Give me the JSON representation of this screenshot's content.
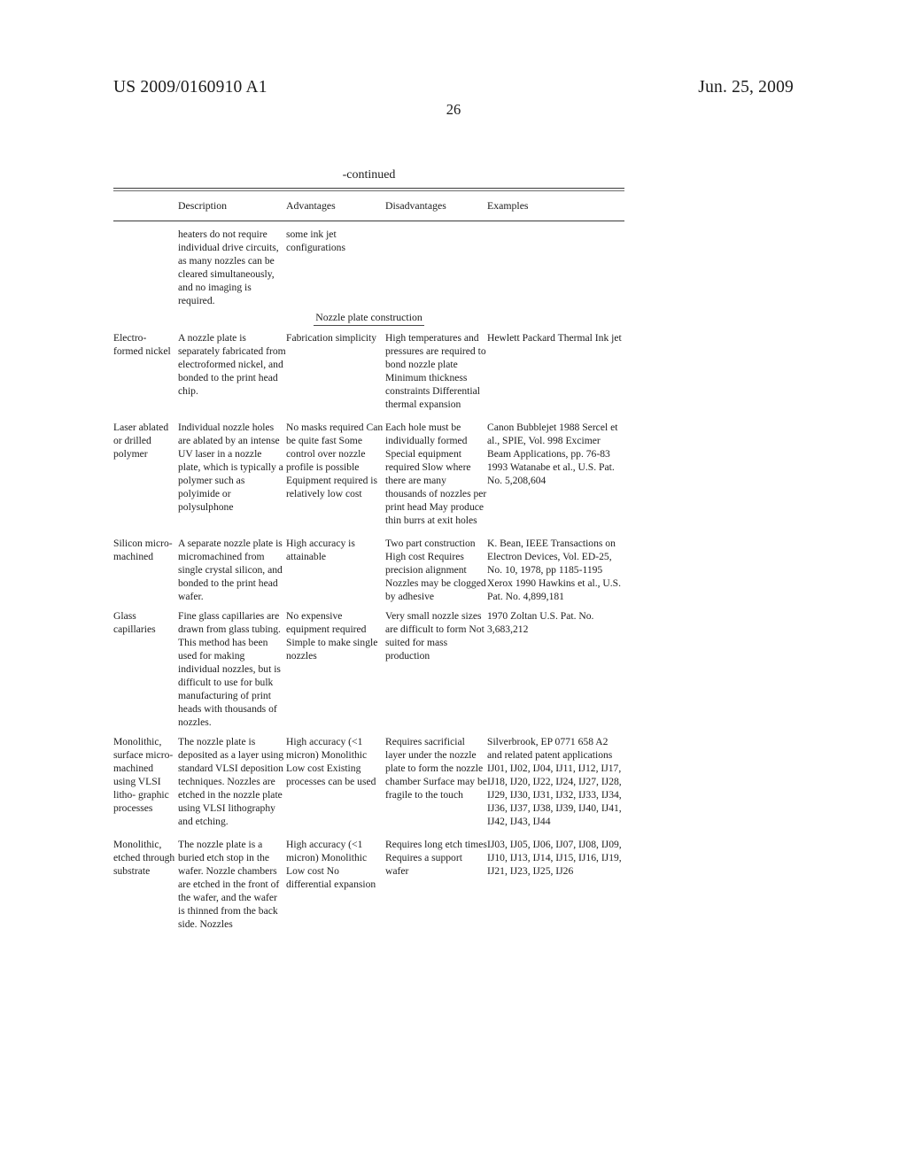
{
  "header": {
    "publication_number": "US 2009/0160910 A1",
    "publication_date": "Jun. 25, 2009",
    "page_number": "26"
  },
  "table": {
    "continued_label": "-continued",
    "columns": [
      "",
      "Description",
      "Advantages",
      "Disadvantages",
      "Examples"
    ],
    "section_heading": "Nozzle plate construction",
    "rows": [
      {
        "name": "",
        "description": "heaters do not\nrequire individual\ndrive circuits, as\nmany nozzles can\nbe cleared\nsimultaneously,\nand no imaging is\nrequired.",
        "advantages": "some ink jet\nconfigurations",
        "disadvantages": "",
        "examples": ""
      },
      {
        "name": "Electro-\nformed\nnickel",
        "description": "A nozzle plate is\nseparately\nfabricated from\nelectroformed\nnickel, and bonded\nto the print head\nchip.",
        "advantages": "Fabrication\nsimplicity",
        "disadvantages": "High temperatures\nand pressures are\nrequired to bond\nnozzle plate\nMinimum\nthickness\nconstraints\nDifferential thermal\nexpansion",
        "examples": "Hewlett Packard\nThermal Ink jet"
      },
      {
        "name": "Laser\nablated or\ndrilled\npolymer",
        "description": "Individual nozzle\nholes are ablated by\nan intense UV laser\nin a nozzle plate,\nwhich is typically a\npolymer such as\npolyimide or\npolysulphone",
        "advantages": "No masks required\nCan be quite fast\nSome control over\nnozzle profile is\npossible\nEquipment\nrequired is\nrelatively low cost",
        "disadvantages": "Each hole must be\nindividually\nformed\nSpecial equipment\nrequired\nSlow where there\nare many thousands\nof nozzles per print\nhead\nMay produce thin\nburrs at exit holes",
        "examples": "Canon Bubblejet\n1988 Sercel et al.,\nSPIE, Vol. 998\nExcimer Beam\nApplications, pp.\n76-83\n1993 Watanabe et\nal., U.S. Pat. No. 5,208,604"
      },
      {
        "name": "Silicon\nmicro-\nmachined",
        "description": "A separate nozzle\nplate is\nmicromachined\nfrom single crystal\nsilicon, and bonded\nto the print head\nwafer.",
        "advantages": "High accuracy is\nattainable",
        "disadvantages": "Two part\nconstruction\nHigh cost\nRequires precision\nalignment\nNozzles may be\nclogged by\nadhesive",
        "examples": "K. Bean, IEEE\nTransactions on\nElectron Devices,\nVol. ED-25, No.\n10, 1978, pp 1185-1195\nXerox 1990\nHawkins et al.,\nU.S. Pat. No. 4,899,181"
      },
      {
        "name": "Glass\ncapillaries",
        "description": "Fine glass\ncapillaries are\ndrawn from glass\ntubing. This\nmethod has been\nused for making\nindividual nozzles,\nbut is difficult to\nuse for bulk\nmanufacturing of\nprint heads with\nthousands of\nnozzles.",
        "advantages": "No expensive\nequipment required\nSimple to make\nsingle nozzles",
        "disadvantages": "Very small nozzle\nsizes are difficult to\nform\nNot suited for mass\nproduction",
        "examples": "1970 Zoltan U.S. Pat. No.\n3,683,212"
      },
      {
        "name": "Monolithic,\nsurface\nmicro-\nmachined\nusing\nVLSI\nlitho-\ngraphic\nprocesses",
        "description": "The nozzle plate is\ndeposited as a layer\nusing standard\nVLSI deposition\ntechniques.\nNozzles are etched\nin the nozzle plate\nusing VLSI\nlithography and\netching.",
        "advantages": "High accuracy (<1\nmicron)\nMonolithic\nLow cost\nExisting processes\ncan be used",
        "disadvantages": "Requires sacrificial\nlayer under the\nnozzle plate to\nform the nozzle\nchamber\nSurface may be\nfragile to the touch",
        "examples": "Silverbrook, EP\n0771 658 A2 and\nrelated patent\napplications\nIJ01, IJ02, IJ04,\nIJ11, IJ12, IJ17,\nIJ18, IJ20, IJ22,\nIJ24, IJ27, IJ28,\nIJ29, IJ30, IJ31,\nIJ32, IJ33, IJ34,\nIJ36, IJ37, IJ38,\nIJ39, IJ40, IJ41,\nIJ42, IJ43, IJ44"
      },
      {
        "name": "Monolithic,\netched\nthrough\nsubstrate",
        "description": "The nozzle plate is\na buried etch stop\nin the wafer.\nNozzle chambers\nare etched in the\nfront of the wafer,\nand the wafer is\nthinned from the\nback side. Nozzles",
        "advantages": "High accuracy (<1\nmicron)\nMonolithic\nLow cost\nNo differential\nexpansion",
        "disadvantages": "Requires long etch\ntimes\nRequires a support\nwafer",
        "examples": "IJ03, IJ05, IJ06,\nIJ07, IJ08, IJ09,\nIJ10, IJ13, IJ14,\nIJ15, IJ16, IJ19,\nIJ21, IJ23, IJ25,\nIJ26"
      }
    ]
  }
}
